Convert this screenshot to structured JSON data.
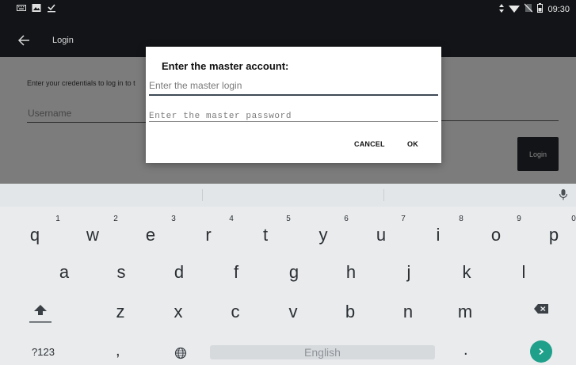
{
  "status_bar": {
    "time": "09:30",
    "left_icons": [
      "keyboard-icon",
      "image-icon",
      "download-done-icon"
    ],
    "right_icons": [
      "data-arrows-icon",
      "wifi-icon",
      "no-sim-icon",
      "battery-icon"
    ]
  },
  "app_bar": {
    "title": "Login"
  },
  "login_screen": {
    "instructions": "Enter your credentials to log in to t",
    "username_label": "Username",
    "login_button_label": "Login"
  },
  "dialog": {
    "title": "Enter the master account:",
    "login_placeholder": "Enter the master login",
    "password_placeholder": "Enter the master password",
    "cancel_label": "CANCEL",
    "ok_label": "OK"
  },
  "keyboard": {
    "row1": [
      "q",
      "w",
      "e",
      "r",
      "t",
      "y",
      "u",
      "i",
      "o",
      "p"
    ],
    "row1_numbers": [
      "1",
      "2",
      "3",
      "4",
      "5",
      "6",
      "7",
      "8",
      "9",
      "0"
    ],
    "row2": [
      "a",
      "s",
      "d",
      "f",
      "g",
      "h",
      "j",
      "k",
      "l"
    ],
    "row3": [
      "z",
      "x",
      "c",
      "v",
      "b",
      "n",
      "m"
    ],
    "symbols_label": "?123",
    "comma_label": ",",
    "period_label": ".",
    "space_label": "English",
    "accent_color": "#1ea08a"
  }
}
